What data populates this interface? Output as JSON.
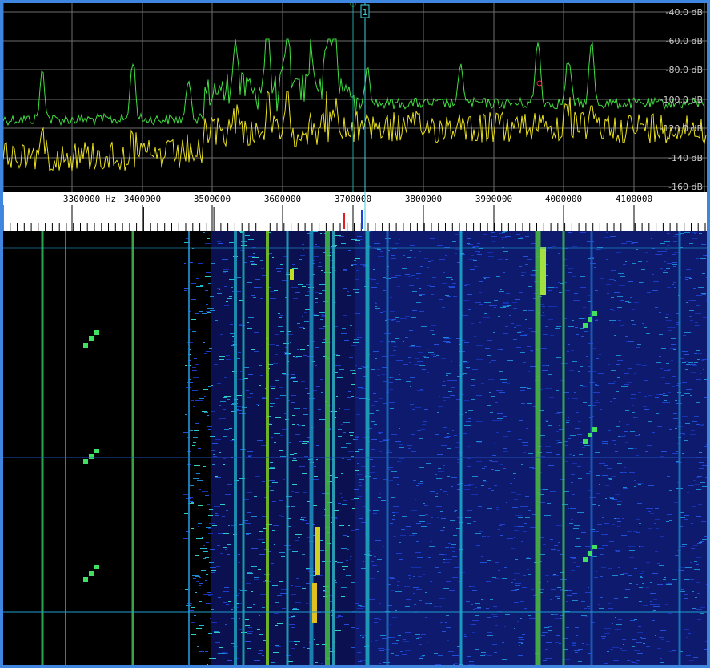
{
  "spectrum": {
    "db_labels": [
      "-40.0 dB",
      "-60.0 dB",
      "-80.0 dB",
      "-100.0 dB",
      "-120.0 dB",
      "-140 dB",
      "-160 dB"
    ],
    "marker_label": "1"
  },
  "frequency_scale": {
    "labels": [
      "3300000 Hz",
      "3400000",
      "3500000",
      "3600000",
      "3700000",
      "3800000",
      "3900000",
      "4000000",
      "4100000"
    ]
  },
  "colors": {
    "peak_trace": "#40e040",
    "live_trace": "#e8e020",
    "grid": "#6e6e6e",
    "marker": "#40d0e0",
    "frame": "#3f86e0"
  }
}
